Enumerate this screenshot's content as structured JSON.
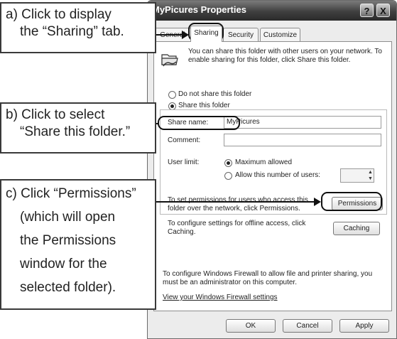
{
  "dialog": {
    "title": "MyPicures Properties",
    "help_label": "?",
    "close_label": "X",
    "tabs": [
      {
        "label": "General"
      },
      {
        "label": "Sharing"
      },
      {
        "label": "Security"
      },
      {
        "label": "Customize"
      }
    ],
    "description": "You can share this folder with other users on your network. To enable sharing for this folder, click Share this folder.",
    "options": {
      "do_not_share": "Do not share this folder",
      "share": "Share this folder",
      "selected": "share"
    },
    "share_name_label": "Share name:",
    "share_name_value": "MyPicures",
    "comment_label": "Comment:",
    "comment_value": "",
    "user_limit_label": "User limit:",
    "maximum_allowed": "Maximum allowed",
    "allow_number": "Allow this number of users:",
    "permissions_text": "To set permissions for users who access this folder over the network, click Permissions.",
    "permissions_button": "Permissions",
    "caching_text": "To configure settings for offline access, click Caching.",
    "caching_button": "Caching",
    "firewall_text": "To configure Windows Firewall to allow file and printer sharing, you must be an administrator on this computer.",
    "firewall_link": "View your Windows Firewall settings",
    "ok_button": "OK",
    "cancel_button": "Cancel",
    "apply_button": "Apply"
  },
  "callouts": {
    "a_line1": "a) Click to display",
    "a_line2": "the “Sharing” tab.",
    "b_line1": "b) Click to select",
    "b_line2": "“Share this folder.”",
    "c_line1": "c) Click “Permissions”",
    "c_line2": "(which will open",
    "c_line3": "the Permissions",
    "c_line4": "window for the",
    "c_line5": "selected folder)."
  }
}
